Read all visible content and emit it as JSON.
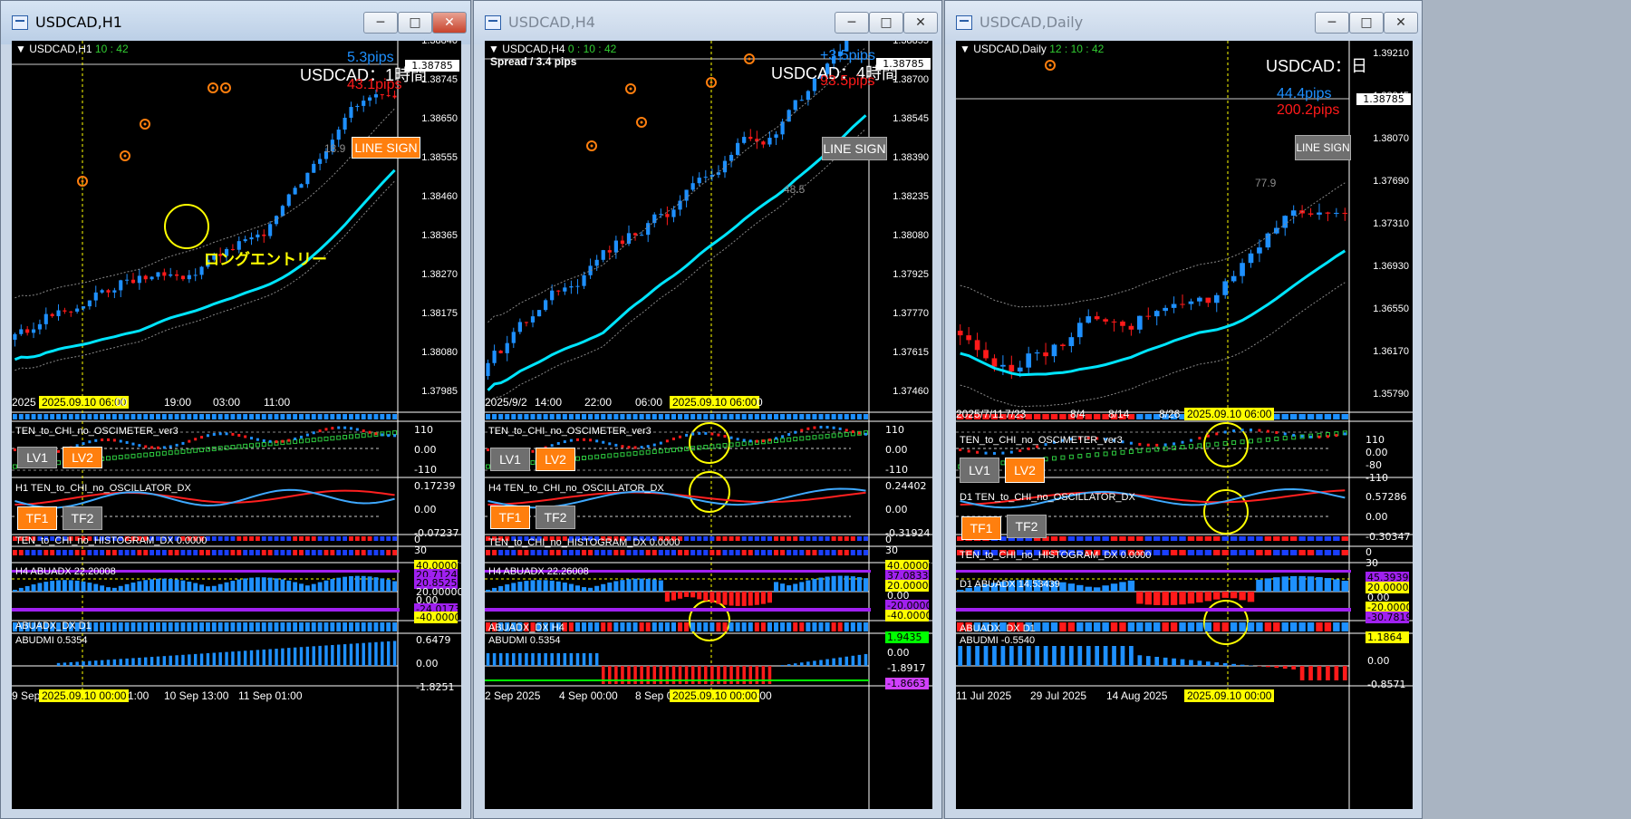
{
  "windows": [
    {
      "title": "USDCAD,H1",
      "symbol": "USDCAD,H1",
      "clock": "10 : 42",
      "header_label": "USDCAD：1時間",
      "pips_top": "5.3pips",
      "pips_bottom": "43.1pips",
      "line_sign": "LINE SIGN",
      "sign_value": "18.9",
      "current_price": "1.38785",
      "price_axis": [
        "1.38840",
        "1.38745",
        "1.38650",
        "1.38555",
        "1.38460",
        "1.38365",
        "1.38270",
        "1.38175",
        "1.38080",
        "1.37985"
      ],
      "time_axis": [
        "2025",
        "2025.09.10 06:00",
        "00",
        "19:00",
        "03:00",
        "11:00"
      ],
      "annotation": "ロングエントリー",
      "ind1_name": "TEN_to_CHI_no_OSCIMETER_ver3",
      "ind1_axis": [
        "110",
        "0.00",
        "-110"
      ],
      "lv1": "LV1",
      "lv2": "LV2",
      "ind2_name": "H1 TEN_to_CHI_no_OSCILLATOR_DX",
      "ind2_axis": [
        "0.17239",
        "0.00",
        "-0.07237"
      ],
      "tf1": "TF1",
      "tf2": "TF2",
      "ind3_name": "TEN_to_CHI_no_HISTOGRAM_DX 0.0000",
      "ind3_axis": [
        "0",
        "30"
      ],
      "ind4_name": "H4 ABUADX  22.20008",
      "ind4_axis": [
        "40.00000",
        "20.71242",
        "20.85255",
        "20.00000",
        "0.00",
        "-24.01734",
        "-40.00000"
      ],
      "ind5_name": "ABUADX_DX D1",
      "ind6_name": "ABUDMI  0.5354",
      "ind6_axis": [
        "0.6479",
        "0.00",
        "-1.8251"
      ],
      "bottom_axis": [
        "9 Sep",
        "2025.09.10 00:00",
        "1:00",
        "10 Sep 13:00",
        "11 Sep 01:00"
      ]
    },
    {
      "title": "USDCAD,H4",
      "symbol": "USDCAD,H4",
      "clock": "0 : 10 : 42",
      "spread": "Spread / 3.4 pips",
      "header_label": "USDCAD：4時間",
      "pips_top": "+3.5pips",
      "pips_bottom": "93.5pips",
      "line_sign": "LINE SIGN",
      "sign_value": "48.5",
      "current_price": "1.38785",
      "price_axis": [
        "1.38855",
        "1.38700",
        "1.38545",
        "1.38390",
        "1.38235",
        "1.38080",
        "1.37925",
        "1.37770",
        "1.37615",
        "1.37460"
      ],
      "time_axis": [
        "2025/9/2",
        "14:00",
        "22:00",
        "06:00",
        "2025.09.10 06:00",
        "0"
      ],
      "ind1_name": "TEN_to_CHI_no_OSCIMETER_ver3",
      "ind1_axis": [
        "110",
        "0.00",
        "-110"
      ],
      "lv1": "LV1",
      "lv2": "LV2",
      "ind2_name": "H4 TEN_to_CHI_no_OSCILLATOR_DX",
      "ind2_axis": [
        "0.24402",
        "0.00",
        "-0.31924"
      ],
      "tf1": "TF1",
      "tf2": "TF2",
      "ind3_name": "TEN_to_CHI_no_HISTOGRAM_DX 0.0000",
      "ind3_axis": [
        "0",
        "30"
      ],
      "ind4_name": "H4 ABUADX  22.26008",
      "ind4_axis": [
        "40.00000",
        "37.08333",
        "20.00000",
        "0.00",
        "-20.00000",
        "-40.00000"
      ],
      "ind5_name": "ABUADX_DX H4",
      "ind6_name": "ABUDMI  0.5354",
      "ind6_axis": [
        "1.9435",
        "0.00",
        "-1.8917",
        "-1.8663"
      ],
      "bottom_axis": [
        "2 Sep 2025",
        "4 Sep 00:00",
        "8 Sep 0",
        "2025.09.10 00:00",
        ":00"
      ]
    },
    {
      "title": "USDCAD,Daily",
      "symbol": "USDCAD,Daily",
      "clock": "12 : 10 : 42",
      "header_label": "USDCAD：日",
      "pips_top": "44.4pips",
      "pips_bottom": "200.2pips",
      "line_sign": "LINE SIGN",
      "sign_value": "77.9",
      "current_price": "1.38785",
      "price_axis": [
        "1.39210",
        "1.38845",
        "1.38070",
        "1.37690",
        "1.37310",
        "1.36930",
        "1.36550",
        "1.36170",
        "1.35790"
      ],
      "time_axis": [
        "2025/7/11",
        "7/23",
        "8/4",
        "8/14",
        "8/26",
        "2025.09.10 06:00"
      ],
      "ind1_name": "TEN_to_CHI_no_OSCIMETER_ver3",
      "ind1_axis": [
        "110",
        "0.00",
        "-80",
        "-110"
      ],
      "lv1": "LV1",
      "lv2": "LV2",
      "ind2_name": "D1 TEN_to_CHI_no_OSCILLATOR_DX",
      "ind2_axis": [
        "0.57286",
        "0.00",
        "-0.30347"
      ],
      "tf1": "TF1",
      "tf2": "TF2",
      "ind3_name": "TEN_to_CHI_no_HISTOGRAM_DX 0.0000",
      "ind3_axis": [
        "0",
        "30"
      ],
      "ind4_name": "D1 ABUADX  14.53439",
      "ind4_axis": [
        "45.39391",
        "20.00000",
        "0.00",
        "-20.00000",
        "-30.78192"
      ],
      "ind5_name": "ABUADX_DX D1",
      "ind6_name": "ABUDMI  -0.5540",
      "ind6_axis": [
        "1.1864",
        "0.00",
        "-0.8571"
      ],
      "bottom_axis": [
        "11 Jul 2025",
        "29 Jul 2025",
        "14 Aug 2025",
        "2025.09.10 00:00"
      ]
    }
  ],
  "colors": {
    "bull": "#1e90ff",
    "bear": "#ff1a1a",
    "ma": "#00e5ff",
    "highlight": "#ffff00",
    "signal": "#ff7f0e"
  }
}
